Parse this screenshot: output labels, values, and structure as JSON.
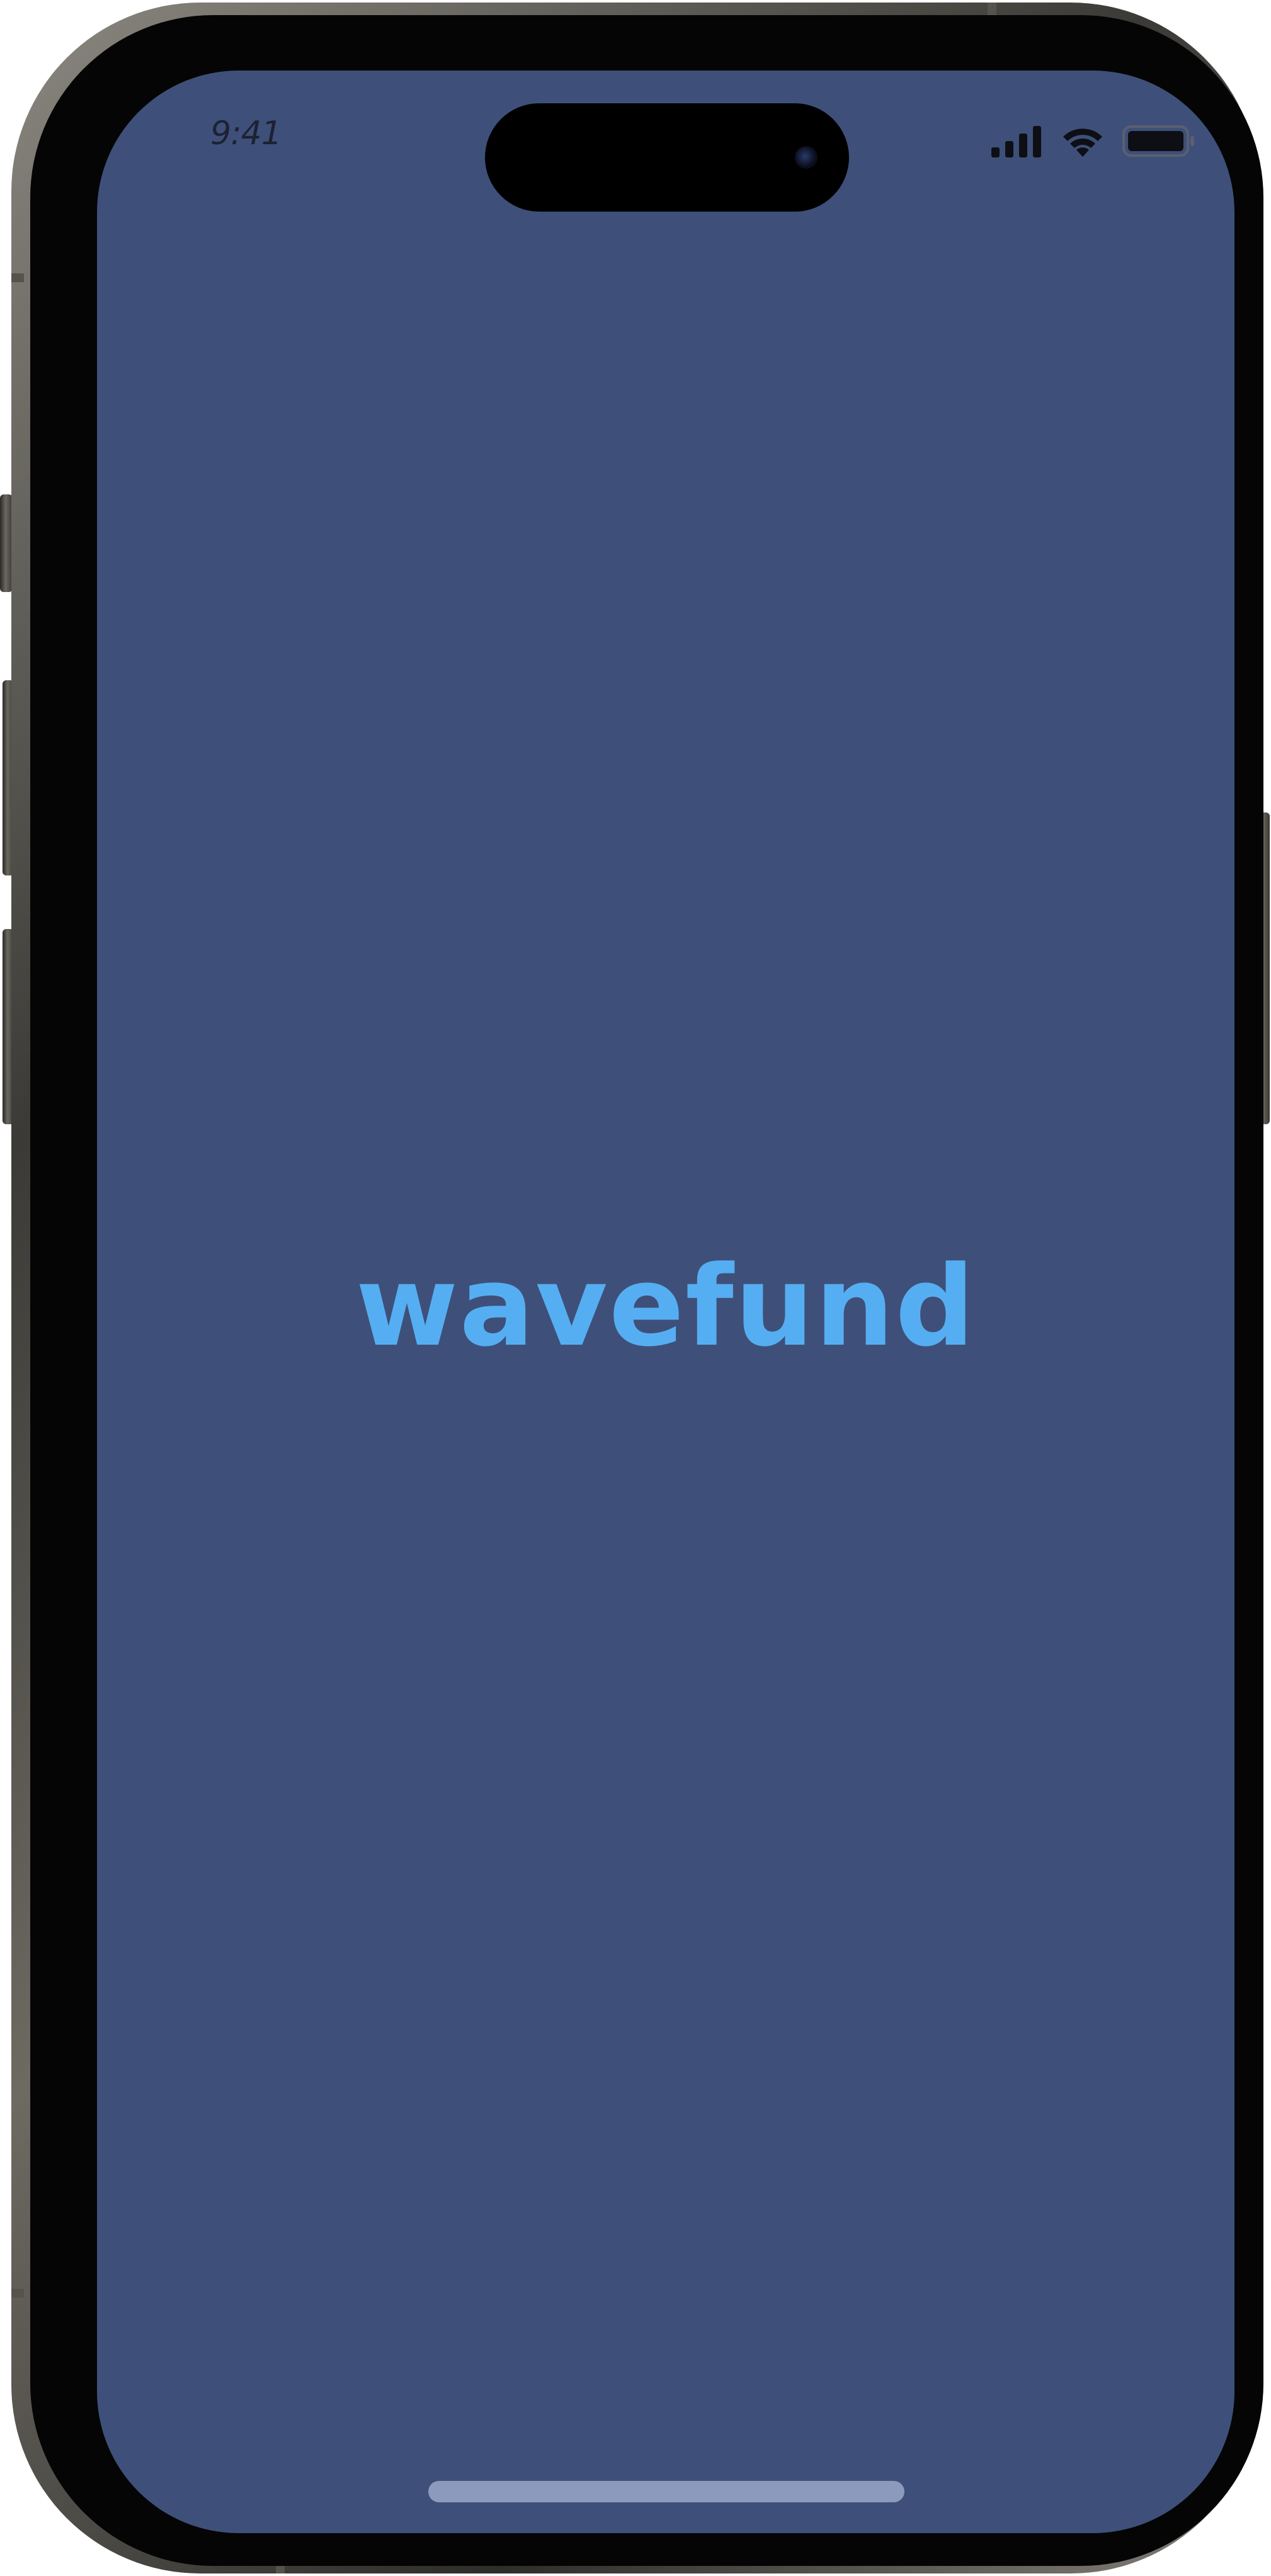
{
  "status_bar": {
    "time": "9:41",
    "signal_icon": "cellular-signal-icon",
    "wifi_icon": "wifi-icon",
    "battery_icon": "battery-icon"
  },
  "splash": {
    "brand_name": "wavefund"
  },
  "colors": {
    "screen_background": "#3e5079",
    "brand_text": "#56aef2",
    "home_indicator": "#8c9bbd"
  }
}
